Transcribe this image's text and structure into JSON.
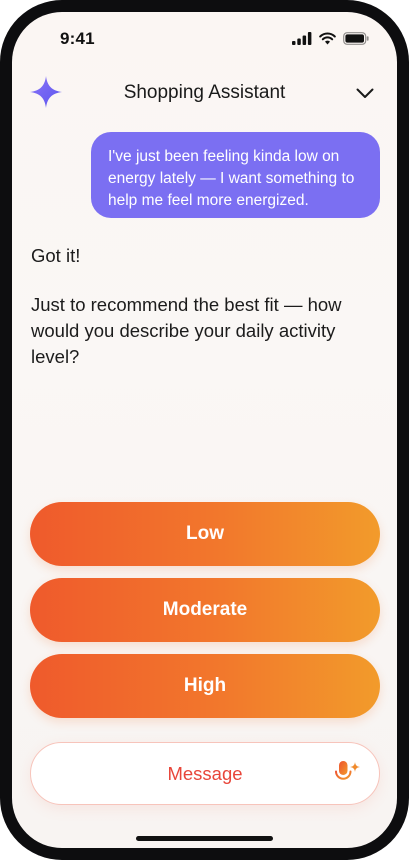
{
  "status_bar": {
    "time": "9:41",
    "icons": [
      "signal-icon",
      "wifi-icon",
      "battery-icon"
    ]
  },
  "header": {
    "title": "Shopping Assistant",
    "left_icon": "sparkle-icon",
    "right_icon": "chevron-down-icon"
  },
  "conversation": {
    "user_message": "I've just been feeling kinda low on energy lately — I want something to help me feel more energized.",
    "assistant_messages": [
      "Got it!",
      "Just to recommend the best fit — how would you describe your daily activity level?"
    ]
  },
  "options": [
    {
      "label": "Low"
    },
    {
      "label": "Moderate"
    },
    {
      "label": "High"
    }
  ],
  "input": {
    "placeholder": "Message",
    "mic_icon": "mic-sparkle-icon"
  },
  "colors": {
    "user_bubble": "#7b6ff2",
    "option_gradient_start": "#ef5a2c",
    "option_gradient_end": "#f29b2b",
    "placeholder_text": "#e8463a",
    "sparkle": "#6f63f3"
  }
}
